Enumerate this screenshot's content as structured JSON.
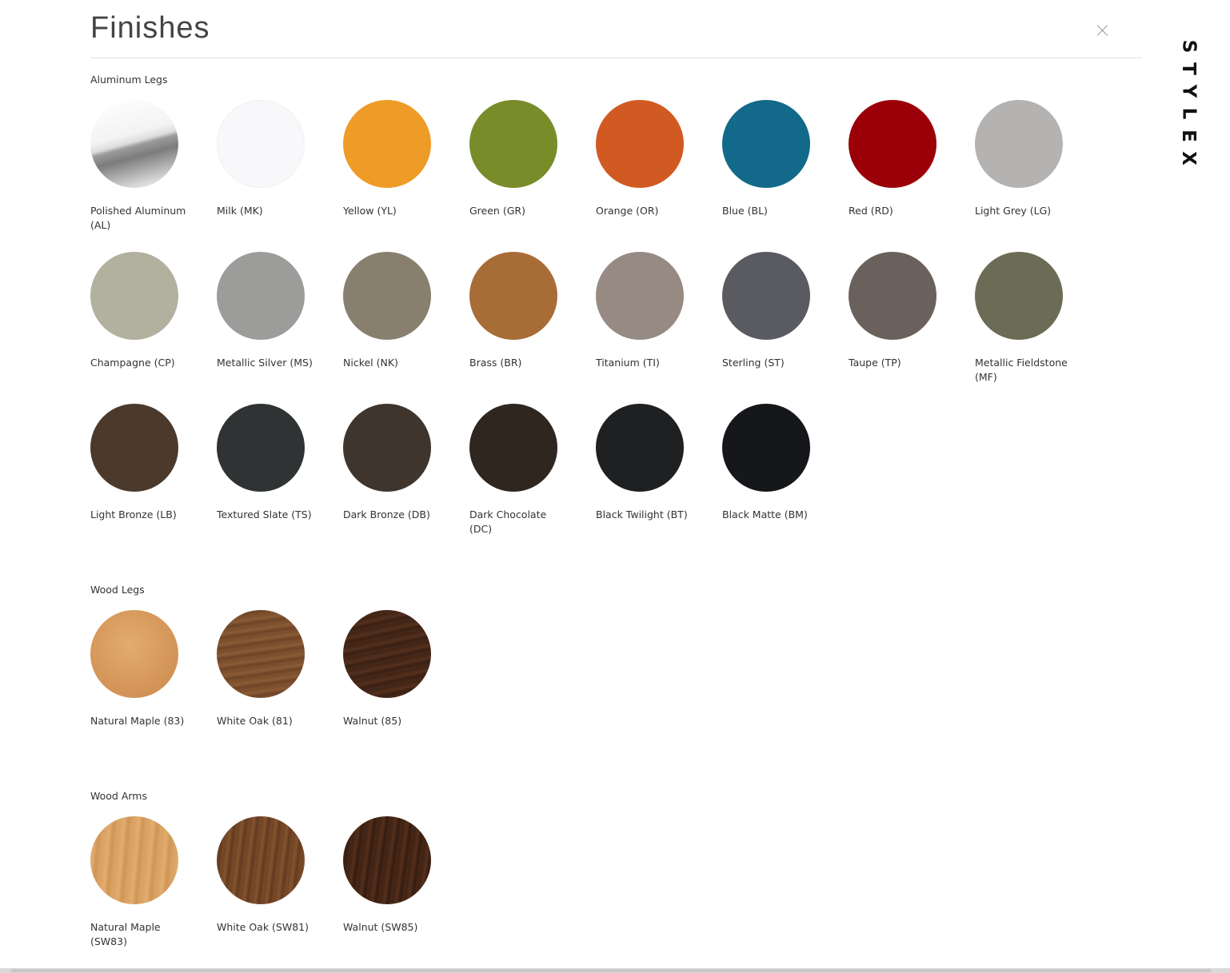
{
  "title": "Finishes",
  "brand": "STYLEX",
  "close_icon": "close-icon",
  "sections": [
    {
      "title": "Aluminum Legs",
      "swatches": [
        {
          "label": "Polished Aluminum (AL)",
          "fill": "linear-gradient(165deg, #ffffff 0%, #f3f3f3 40%, #dcdcdc 48%, #9a9a9a 52%, #7c7c7c 62%, #cfcfcf 85%, #ffffff 100%)"
        },
        {
          "label": "Milk (MK)",
          "fill": "#f8f8fa"
        },
        {
          "label": "Yellow (YL)",
          "fill": "#ef9b27"
        },
        {
          "label": "Green (GR)",
          "fill": "#788c2a"
        },
        {
          "label": "Orange (OR)",
          "fill": "#d15a22"
        },
        {
          "label": "Blue (BL)",
          "fill": "#13698a"
        },
        {
          "label": "Red (RD)",
          "fill": "#9b0009"
        },
        {
          "label": "Light Grey (LG)",
          "fill": "#b5b3b2"
        },
        {
          "label": "Champagne (CP)",
          "fill": "#b2b09f"
        },
        {
          "label": "Metallic Silver (MS)",
          "fill": "#9c9d9b"
        },
        {
          "label": "Nickel (NK)",
          "fill": "#887f6e"
        },
        {
          "label": "Brass (BR)",
          "fill": "#a86c37"
        },
        {
          "label": "Titanium (TI)",
          "fill": "#968a82"
        },
        {
          "label": "Sterling (ST)",
          "fill": "#5a5b60"
        },
        {
          "label": "Taupe (TP)",
          "fill": "#6a605c"
        },
        {
          "label": "Metallic Fieldstone (MF)",
          "fill": "#6c6b55"
        },
        {
          "label": "Light Bronze (LB)",
          "fill": "#4b3a2c"
        },
        {
          "label": "Textured Slate (TS)",
          "fill": "#2f3334"
        },
        {
          "label": "Dark Bronze (DB)",
          "fill": "#3f352c"
        },
        {
          "label": "Dark Chocolate (DC)",
          "fill": "#302620"
        },
        {
          "label": "Black Twilight (BT)",
          "fill": "#1f2022"
        },
        {
          "label": "Black Matte (BM)",
          "fill": "#15171a"
        }
      ]
    },
    {
      "title": "Wood Legs",
      "swatches": [
        {
          "label": "Natural Maple (83)",
          "fill": "radial-gradient(circle at 45% 40%, #e3ab70 0%, #d79a5c 50%, #c98a4c 100%)"
        },
        {
          "label": "White Oak (81)",
          "fill": "repeating-linear-gradient(172deg, #7a4e2c 0px, #8a5b36 5px, #6e4426 9px, #7f5230 13px)"
        },
        {
          "label": "Walnut (85)",
          "fill": "repeating-linear-gradient(168deg, #3f2315 0px, #54301d 6px, #3a2013 10px, #4a2a19 15px)"
        }
      ]
    },
    {
      "title": "Wood Arms",
      "swatches": [
        {
          "label": "Natural Maple (SW83)",
          "fill": "repeating-linear-gradient(95deg, #d9a162 0px, #e2ad6f 7px, #cf9555 12px, #dba566 18px)"
        },
        {
          "label": "White Oak (SW81)",
          "fill": "repeating-linear-gradient(97deg, #6e4223 0px, #84542f 5px, #623a1f 9px, #7a4c2a 14px)"
        },
        {
          "label": "Walnut (SW85)",
          "fill": "repeating-linear-gradient(98deg, #3c2113 0px, #552f1b 6px, #351c10 10px, #4a2918 15px)"
        }
      ]
    }
  ]
}
